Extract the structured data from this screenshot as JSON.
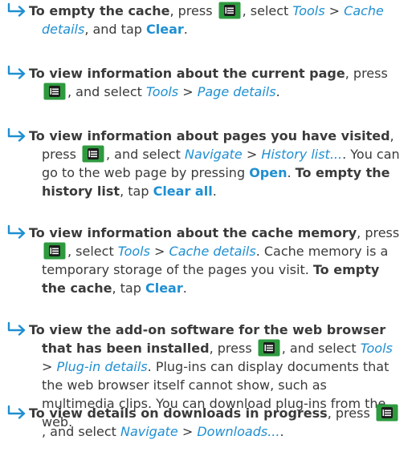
{
  "sections": [
    {
      "parts": [
        {
          "t": "b",
          "v": "To empty the cache"
        },
        {
          "t": "n",
          "v": ", press "
        },
        {
          "t": "key"
        },
        {
          "t": "n",
          "v": ", select "
        },
        {
          "t": "m",
          "v": "Tools"
        },
        {
          "t": "n",
          "v": " > "
        },
        {
          "t": "m",
          "v": "Cache details"
        },
        {
          "t": "n",
          "v": ", and tap "
        },
        {
          "t": "u",
          "v": "Clear"
        },
        {
          "t": "n",
          "v": "."
        }
      ]
    },
    {
      "parts": [
        {
          "t": "b",
          "v": "To view information about the current page"
        },
        {
          "t": "n",
          "v": ", press "
        },
        {
          "t": "key"
        },
        {
          "t": "n",
          "v": ", and select "
        },
        {
          "t": "m",
          "v": "Tools"
        },
        {
          "t": "n",
          "v": " > "
        },
        {
          "t": "m",
          "v": "Page details"
        },
        {
          "t": "n",
          "v": "."
        }
      ]
    },
    {
      "parts": [
        {
          "t": "b",
          "v": "To view information about pages you have visited"
        },
        {
          "t": "n",
          "v": ", press "
        },
        {
          "t": "key"
        },
        {
          "t": "n",
          "v": ", and select "
        },
        {
          "t": "m",
          "v": "Navigate"
        },
        {
          "t": "n",
          "v": " > "
        },
        {
          "t": "m",
          "v": "History list..."
        },
        {
          "t": "n",
          "v": ". You can go to the web page by pressing "
        },
        {
          "t": "u",
          "v": "Open"
        },
        {
          "t": "n",
          "v": ". "
        },
        {
          "t": "b",
          "v": "To empty the history list"
        },
        {
          "t": "n",
          "v": ", tap "
        },
        {
          "t": "u",
          "v": "Clear all"
        },
        {
          "t": "n",
          "v": "."
        }
      ]
    },
    {
      "parts": [
        {
          "t": "b",
          "v": "To view information about the cache memory"
        },
        {
          "t": "n",
          "v": ", press "
        },
        {
          "t": "key"
        },
        {
          "t": "n",
          "v": ", select "
        },
        {
          "t": "m",
          "v": "Tools"
        },
        {
          "t": "n",
          "v": " > "
        },
        {
          "t": "m",
          "v": "Cache details"
        },
        {
          "t": "n",
          "v": ". Cache memory is a temporary storage of the pages you visit. "
        },
        {
          "t": "b",
          "v": "To empty the cache"
        },
        {
          "t": "n",
          "v": ", tap "
        },
        {
          "t": "u",
          "v": "Clear"
        },
        {
          "t": "n",
          "v": "."
        }
      ]
    },
    {
      "parts": [
        {
          "t": "b",
          "v": "To view the add-on software for the web browser that has been installed"
        },
        {
          "t": "n",
          "v": ", press "
        },
        {
          "t": "key"
        },
        {
          "t": "n",
          "v": ", and select "
        },
        {
          "t": "m",
          "v": "Tools"
        },
        {
          "t": "n",
          "v": " > "
        },
        {
          "t": "m",
          "v": "Plug-in details"
        },
        {
          "t": "n",
          "v": ". Plug-ins can display documents that the web browser itself cannot show, such as multimedia clips. You can download plug-ins from the web."
        }
      ]
    },
    {
      "parts": [
        {
          "t": "b",
          "v": "To view details on downloads in progress"
        },
        {
          "t": "n",
          "v": ", press "
        },
        {
          "t": "key"
        },
        {
          "t": "n",
          "v": ", and select "
        },
        {
          "t": "m",
          "v": "Navigate"
        },
        {
          "t": "n",
          "v": " > "
        },
        {
          "t": "m",
          "v": "Downloads..."
        },
        {
          "t": "n",
          "v": "."
        }
      ]
    }
  ],
  "colors": {
    "accent": "#1f8fd1",
    "text": "#3a3a3a",
    "key_bg": "#2e9a3e"
  },
  "icons": {
    "bullet": "arrow-right-icon",
    "key": "menu-key-icon"
  }
}
